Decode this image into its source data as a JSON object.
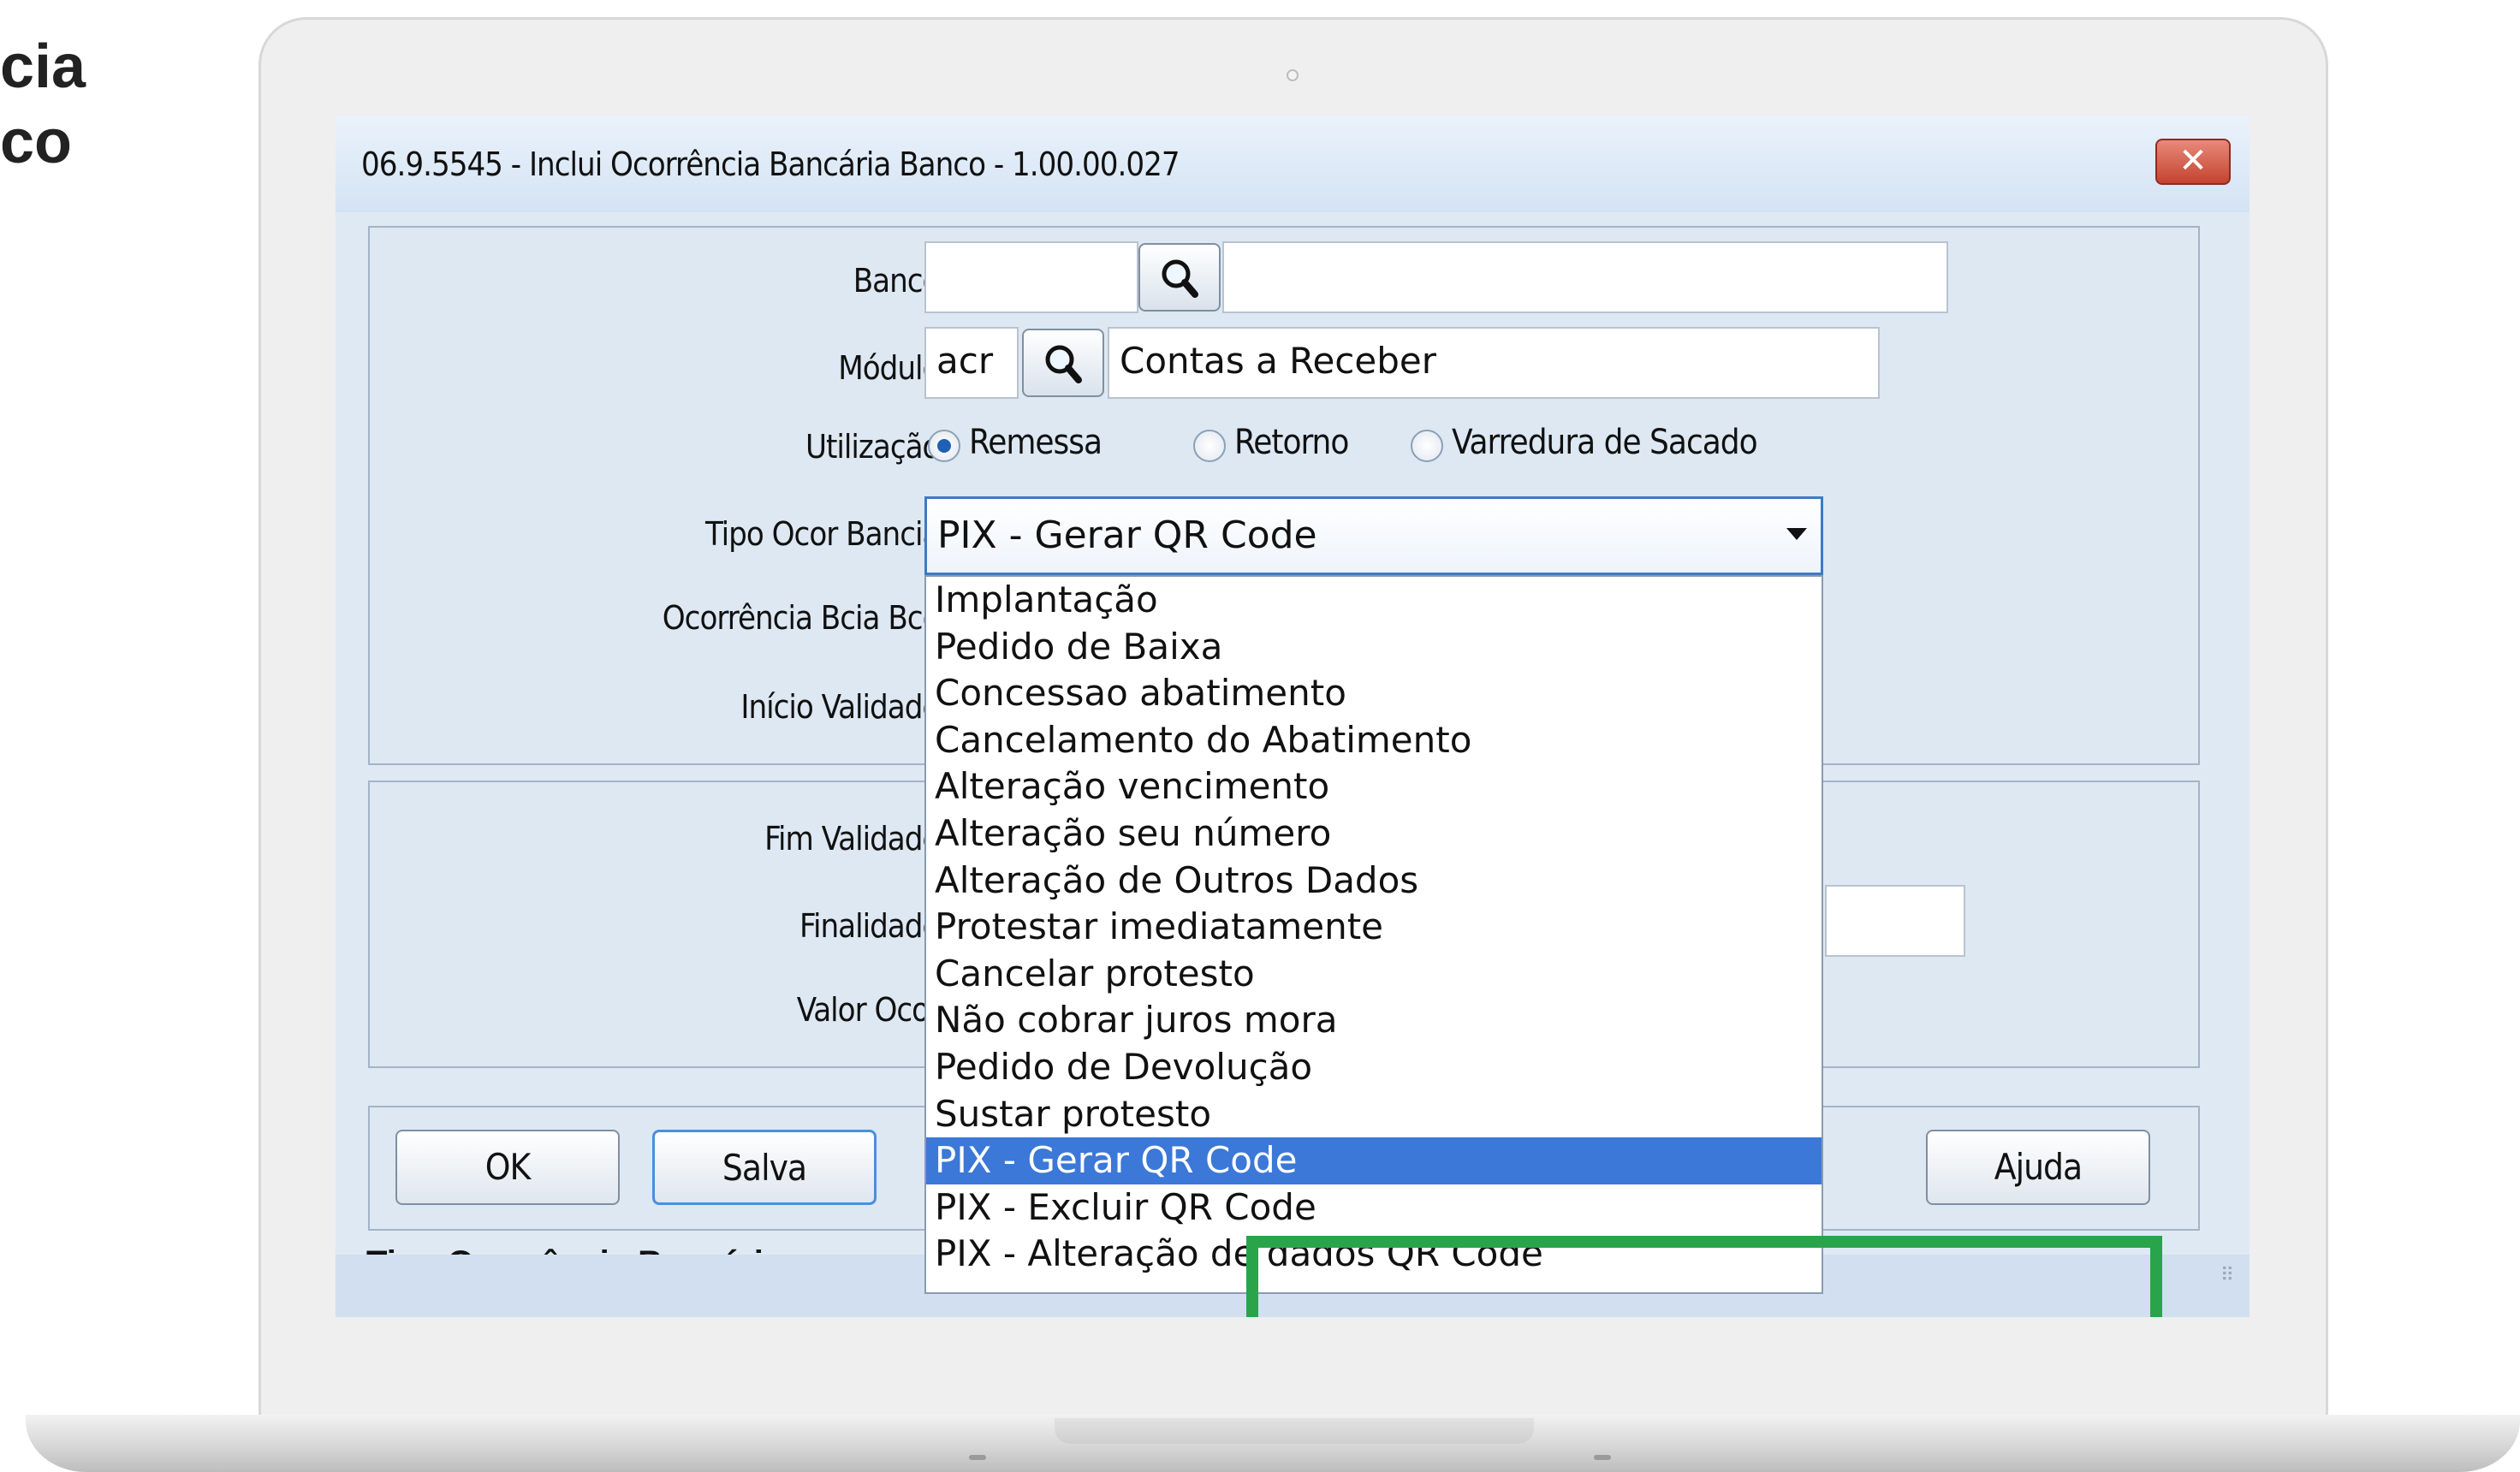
{
  "side_text": {
    "line1": "cia",
    "line2": "co"
  },
  "window": {
    "title": "06.9.5545 - Inclui Ocorrência Bancária Banco - 1.00.00.027",
    "close_label": "✕"
  },
  "form": {
    "banco": {
      "label": "Banco:",
      "code": "",
      "description": ""
    },
    "modulo": {
      "label": "Módulo:",
      "code": "acr",
      "description": "Contas a Receber"
    },
    "utilizacao": {
      "label": "Utilização:",
      "options": [
        "Remessa",
        "Retorno",
        "Varredura de Sacado"
      ],
      "selected": "Remessa"
    },
    "tipo_ocor": {
      "label": "Tipo Ocor Bancia:",
      "value": "PIX - Gerar QR Code"
    },
    "ocorrencia_bcia_bco": {
      "label": "Ocorrência Bcia Bco:"
    },
    "inicio_validade": {
      "label": "Início Validade:"
    },
    "fim_validade": {
      "label": "Fim Validade:"
    },
    "finalidade": {
      "label": "Finalidade:"
    },
    "valor_ocor": {
      "label": "Valor Ocor:"
    }
  },
  "dropdown": {
    "options": [
      "Implantação",
      "Pedido de Baixa",
      "Concessao abatimento",
      "Cancelamento do Abatimento",
      "Alteração vencimento",
      "Alteração seu número",
      "Alteração de Outros Dados",
      "Protestar imediatamente",
      "Cancelar protesto",
      "Não cobrar juros mora",
      "Pedido de Devolução",
      "Sustar protesto",
      "PIX - Gerar QR Code",
      "PIX - Excluir QR Code",
      "PIX - Alteração de dados QR Code"
    ],
    "selected_index": 12
  },
  "buttons": {
    "ok": "OK",
    "salva": "Salva",
    "ajuda": "Ajuda"
  },
  "footer_label": "Tipo Ocorrência Bancária",
  "colors": {
    "highlight": "#2aa44a",
    "selection": "#3b78d8"
  }
}
